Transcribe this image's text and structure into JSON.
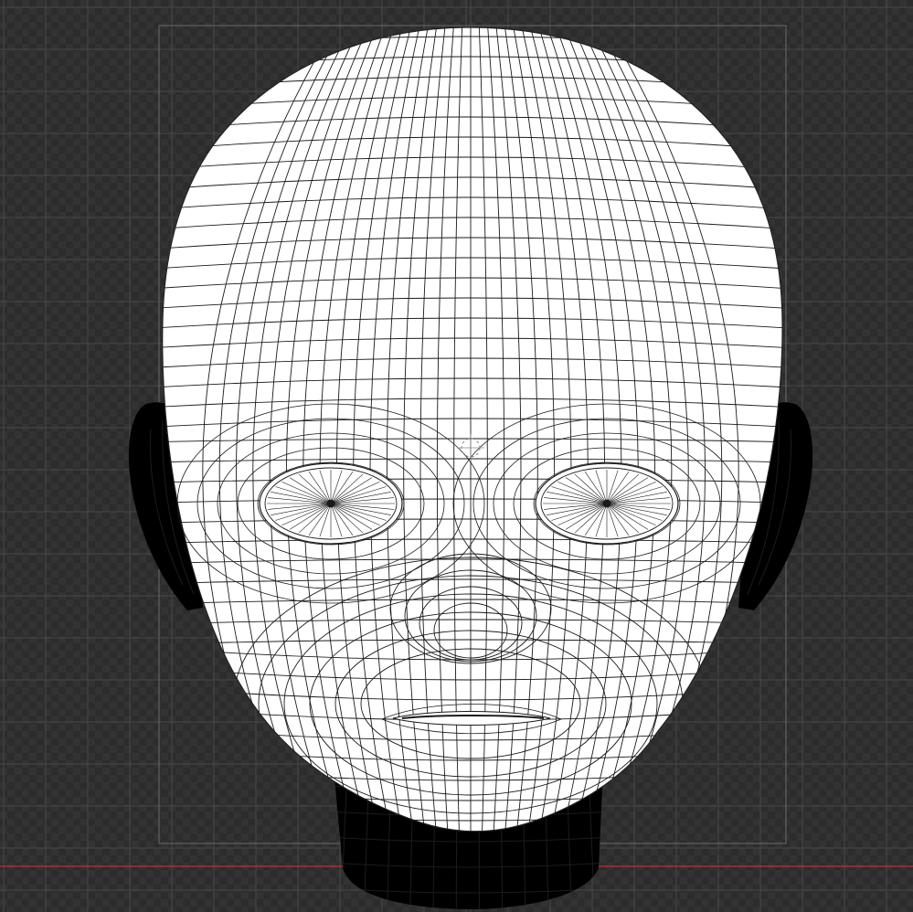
{
  "viewport": {
    "view": "front-orthographic",
    "object": "head-mesh",
    "shading": "wireframe-on-shaded",
    "grid_visible": true,
    "axis_visible": true,
    "colors": {
      "background_dark": "#2c2c2c",
      "background_light": "#333333",
      "grid_line": "#4a4a4a",
      "frame_line": "#6a6a6a",
      "x_axis": "#c0303a",
      "z_axis": "#4a4a4a",
      "mesh_surface": "#ffffff",
      "mesh_wire": "#1a1a1a",
      "mesh_shadow": "#000000"
    },
    "icons": [
      "object-origin-icon",
      "3d-cursor-icon"
    ]
  }
}
